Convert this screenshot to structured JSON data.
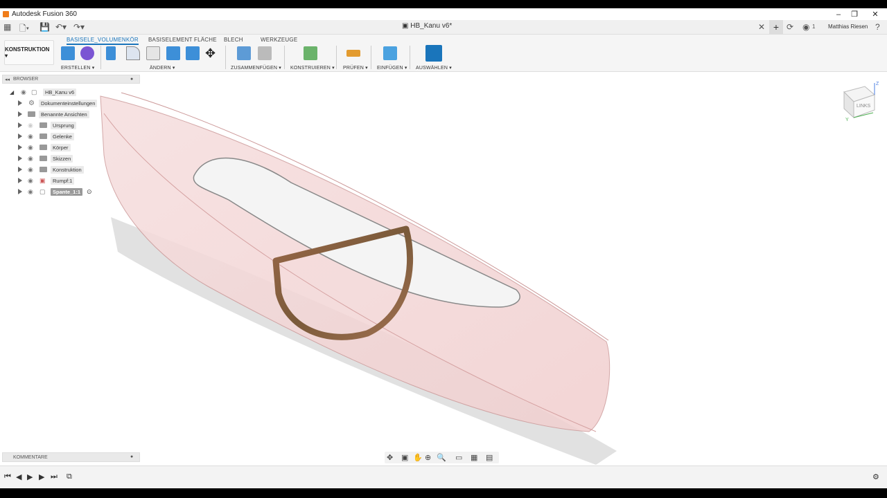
{
  "app": {
    "window_title": "Autodesk Fusion 360",
    "document_tab": "HB_Kanu v6*",
    "user_name": "Matthias Riesen",
    "job_count": "1"
  },
  "ribbon": {
    "workspace": "KONSTRUKTION ▾",
    "tabs": [
      "BASISELE_VOLUMENKÖR",
      "BASISELEMENT FLÄCHE",
      "BLECH",
      "WERKZEUGE"
    ],
    "groups": [
      "ERSTELLEN ▾",
      "ÄNDERN ▾",
      "ZUSAMMENFÜGEN ▾",
      "KONSTRUIEREN ▾",
      "PRÜFEN ▾",
      "EINFÜGEN ▾",
      "AUSWÄHLEN ▾"
    ]
  },
  "browser": {
    "title": "BROWSER",
    "root": "HB_Kanu v6",
    "items": [
      {
        "label": "Dokumenteinstellungen",
        "icon": "gear-icon"
      },
      {
        "label": "Benannte Ansichten",
        "icon": "folder-icon"
      },
      {
        "label": "Ursprung",
        "icon": "folder-icon"
      },
      {
        "label": "Gelenke",
        "icon": "folder-icon"
      },
      {
        "label": "Körper",
        "icon": "folder-icon"
      },
      {
        "label": "Skizzen",
        "icon": "folder-icon"
      },
      {
        "label": "Konstruktion",
        "icon": "folder-icon"
      },
      {
        "label": "Rumpf:1",
        "icon": "component-icon"
      },
      {
        "label": "Spante_1:1",
        "icon": "component-icon",
        "selected": true
      }
    ]
  },
  "comments": {
    "title": "KOMMENTARE"
  },
  "viewcube": {
    "face_label": "LINKS",
    "axis_z": "Z",
    "axis_y": "Y"
  },
  "colors": {
    "accent": "#1a75bb",
    "hull": "#f2c9c9",
    "frame": "#8a5a3c"
  }
}
